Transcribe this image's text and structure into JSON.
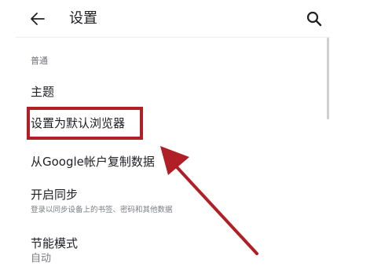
{
  "header": {
    "title": "设置",
    "back_icon": "arrow-left-icon",
    "search_icon": "search-icon"
  },
  "settings": {
    "section_header": "普通",
    "items": [
      {
        "title": "主题"
      },
      {
        "title": "设置为默认浏览器"
      },
      {
        "title": "从Google帐户复制数据"
      },
      {
        "title": "开启同步",
        "summary": "登录以同步设备上的书签、密码和其他数据"
      },
      {
        "title": "节能模式",
        "summary": "自动"
      }
    ]
  },
  "annotation": {
    "color": "#b01e26",
    "highlighted_item": "设置为默认浏览器"
  },
  "colors": {
    "text_primary": "#202124",
    "text_secondary": "#7a7c80",
    "background": "#ffffff"
  }
}
